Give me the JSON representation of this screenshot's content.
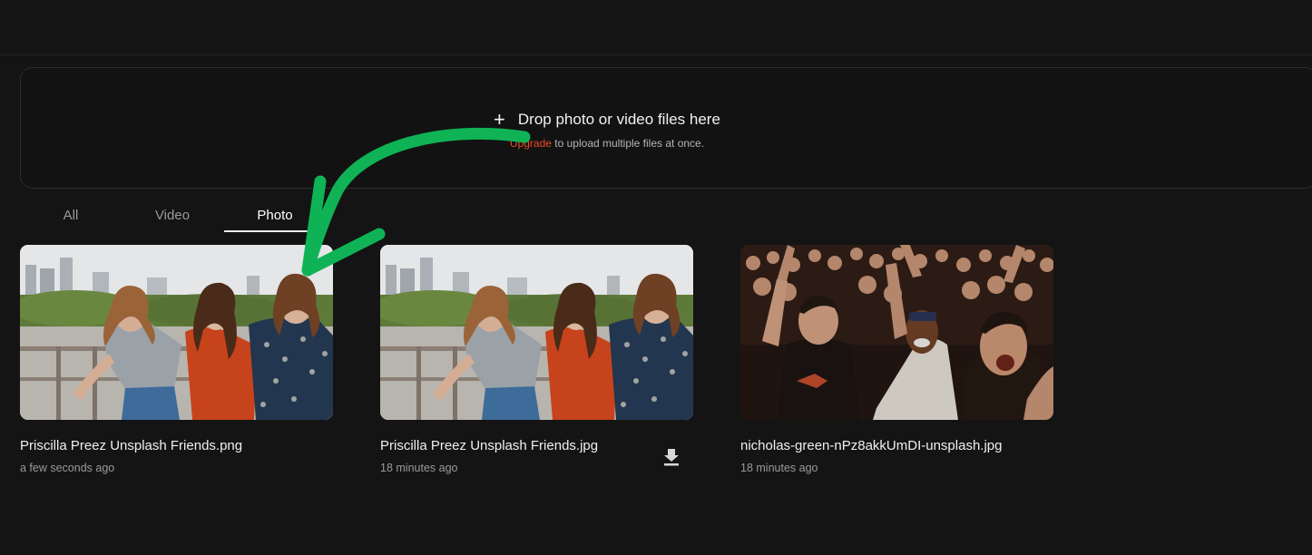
{
  "dropzone": {
    "plus_icon": "plus-icon",
    "title": "Drop photo or video files here",
    "upgrade_link": "Upgrade",
    "subtitle_rest": " to upload multiple files at once."
  },
  "tabs": [
    {
      "label": "All",
      "active": false
    },
    {
      "label": "Video",
      "active": false
    },
    {
      "label": "Photo",
      "active": true
    }
  ],
  "files": [
    {
      "name": "Priscilla Preez Unsplash Friends.png",
      "time": "a few seconds ago",
      "thumbnail": "friends-photo"
    },
    {
      "name": "Priscilla Preez Unsplash Friends.jpg",
      "time": "18 minutes ago",
      "thumbnail": "friends-photo",
      "action_icon": "download-icon"
    },
    {
      "name": "nicholas-green-nPz8akkUmDI-unsplash.jpg",
      "time": "18 minutes ago",
      "thumbnail": "crowd-photo"
    }
  ],
  "annotation": {
    "icon": "green-arrow-icon",
    "color": "#0fb356"
  },
  "colors": {
    "background": "#141414",
    "accent": "#ef4a25",
    "text": "#f2f2f2",
    "muted": "#9a9a9a"
  }
}
